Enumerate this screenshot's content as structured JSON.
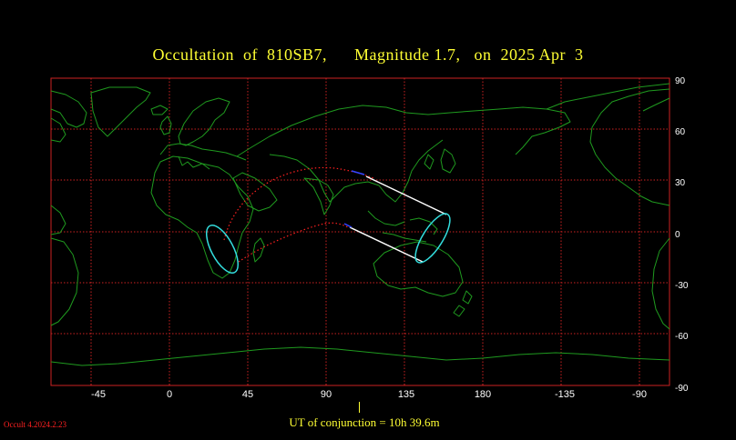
{
  "title": "Occultation  of  810SB7,      Magnitude 1.7,   on  2025 Apr  3",
  "x_ticks": [
    "-45",
    "0",
    "45",
    "90",
    "135",
    "180",
    "-135",
    "-90"
  ],
  "y_ticks": [
    "90",
    "60",
    "30",
    "0",
    "-30",
    "-60",
    "-90"
  ],
  "conjunction": "UT of conjunction = 10h 39.6m",
  "version": "Occult 4.2024.2.23",
  "colors": {
    "title": "#ffff33",
    "grid": "#cc2222",
    "coast": "#1f9a1f",
    "path_center": "#ff2020",
    "path_limits": "#ffffff",
    "shadow_outline": "#33dddd"
  }
}
